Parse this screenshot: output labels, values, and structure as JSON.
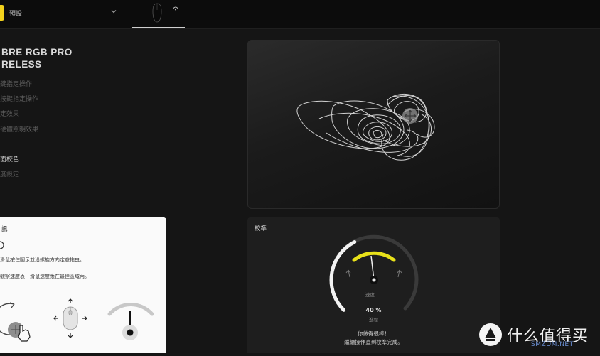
{
  "topbar": {
    "profile_label": "預設",
    "chevron_icon": "chevron-down-icon",
    "device_icon": "mouse-icon",
    "wireless_icon": "wireless-icon",
    "accent": "#f2d11c"
  },
  "device": {
    "name_line1": "BRE RGB PRO",
    "name_line2": "RELESS"
  },
  "menu": [
    {
      "label": "鍵指定操作"
    },
    {
      "label": "按鍵指定操作"
    },
    {
      "label": "定效果"
    },
    {
      "label": "硬體照明效果"
    },
    {
      "label": "面校色"
    },
    {
      "label": "度設定"
    }
  ],
  "calibration": {
    "title": "校準",
    "speed_label": "速度",
    "progress_value": "40 %",
    "progress_label": "進程",
    "progress_fraction": 0.4,
    "message_line1": "你做得很棒！",
    "message_line2": "繼續操作直到校準完成。",
    "accent": "#e8e11a"
  },
  "help": {
    "title": "訊",
    "line1": "滑鼠按住圖示並沿螺旋方向定遊拖曳。",
    "line2": "觀察速度表一滑鼠速度應在最佳區域內。"
  },
  "watermark": {
    "text": "什么值得买",
    "sub": "SMZDM.NET",
    "icon": "logo-icon"
  }
}
